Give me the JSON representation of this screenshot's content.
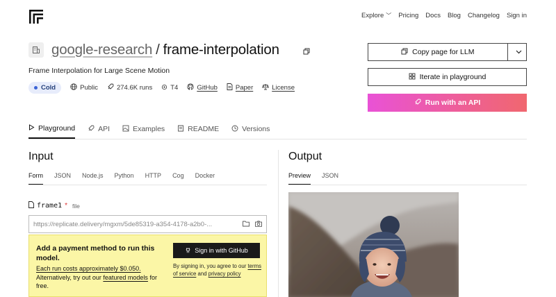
{
  "nav": {
    "explore": "Explore",
    "pricing": "Pricing",
    "docs": "Docs",
    "blog": "Blog",
    "changelog": "Changelog",
    "signin": "Sign in"
  },
  "model": {
    "owner": "google-research",
    "slash": "/",
    "name": "frame-interpolation",
    "description": "Frame Interpolation for Large Scene Motion",
    "status": "Cold",
    "visibility": "Public",
    "runs": "274.6K runs",
    "hardware": "T4",
    "github": "GitHub",
    "paper": "Paper",
    "license": "License"
  },
  "actions": {
    "copy_llm": "Copy page for LLM",
    "iterate": "Iterate in playground",
    "run_api": "Run with an API"
  },
  "tabs": [
    "Playground",
    "API",
    "Examples",
    "README",
    "Versions"
  ],
  "input": {
    "title": "Input",
    "subtabs": [
      "Form",
      "JSON",
      "Node.js",
      "Python",
      "HTTP",
      "Cog",
      "Docker"
    ],
    "field_name": "frame1",
    "field_required": "*",
    "field_type": "file",
    "field_value": "https://replicate.delivery/mgxm/5de85319-a354-4178-a2b0-..."
  },
  "payment": {
    "title": "Add a payment method to run this model.",
    "cost_text": "Each run costs approximately $0.050.",
    "alt_text": "Alternatively, try out our",
    "featured": "featured models",
    "alt_end": "for free.",
    "github_btn": "Sign in with GitHub",
    "terms_pre": "By signing in, you agree to our",
    "terms": "terms of service",
    "and": "and",
    "privacy": "privacy policy"
  },
  "output": {
    "title": "Output",
    "subtabs": [
      "Preview",
      "JSON"
    ]
  },
  "colors": {
    "accent_start": "#e952d6",
    "accent_end": "#f0676f",
    "banner": "#fbf6a6",
    "badge_bg": "#e7ecfb"
  },
  "icons": [
    "replicate-logo-icon",
    "building-icon",
    "copy-icon",
    "globe-icon",
    "rocket-icon",
    "chip-icon",
    "github-icon",
    "document-icon",
    "scale-icon",
    "grid-icon",
    "play-icon",
    "image-icon",
    "book-icon",
    "history-icon",
    "folder-icon",
    "camera-icon",
    "file-icon",
    "chevron-down-icon"
  ]
}
